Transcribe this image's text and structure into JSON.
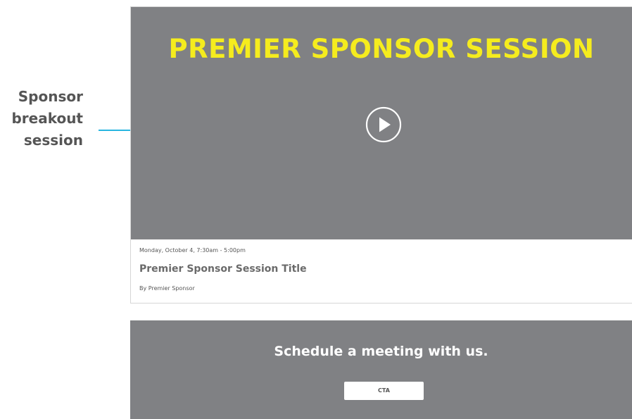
{
  "annotation": {
    "lines": [
      "Sponsor",
      "breakout",
      "session"
    ]
  },
  "session": {
    "video_heading": "PREMIER SPONSOR SESSION",
    "date_time": "Monday, October 4, 7:30am - 5:00pm",
    "title": "Premier Sponsor Session Title",
    "author": "By Premier Sponsor"
  },
  "meeting": {
    "heading": "Schedule a meeting with us.",
    "cta_label": "CTA"
  },
  "icons": {
    "play": "play-circle-icon"
  },
  "colors": {
    "panel_gray": "#808184",
    "heading_yellow": "#f5ec1e",
    "callout_cyan": "#29b6e0",
    "label_gray": "#555555"
  }
}
